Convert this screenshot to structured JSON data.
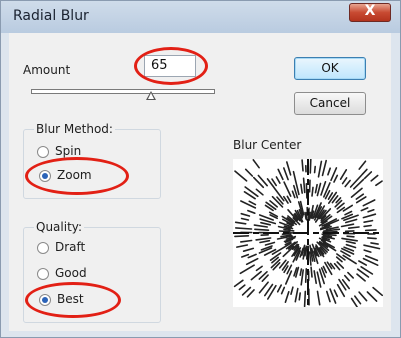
{
  "dialog": {
    "title": "Radial Blur",
    "close_glyph": "X"
  },
  "amount": {
    "label": "Amount",
    "value": "65",
    "slider_value": 65,
    "slider_max": 100
  },
  "buttons": {
    "ok": "OK",
    "cancel": "Cancel"
  },
  "blur_method": {
    "label": "Blur Method:",
    "options": [
      "Spin",
      "Zoom"
    ],
    "selected": "Zoom"
  },
  "quality": {
    "label": "Quality:",
    "options": [
      "Draft",
      "Good",
      "Best"
    ],
    "selected": "Best"
  },
  "blur_center": {
    "label": "Blur Center"
  },
  "colors": {
    "highlight_ellipse": "#e22015",
    "titlebar": "#c6d6e8",
    "close_button": "#c84a32"
  }
}
